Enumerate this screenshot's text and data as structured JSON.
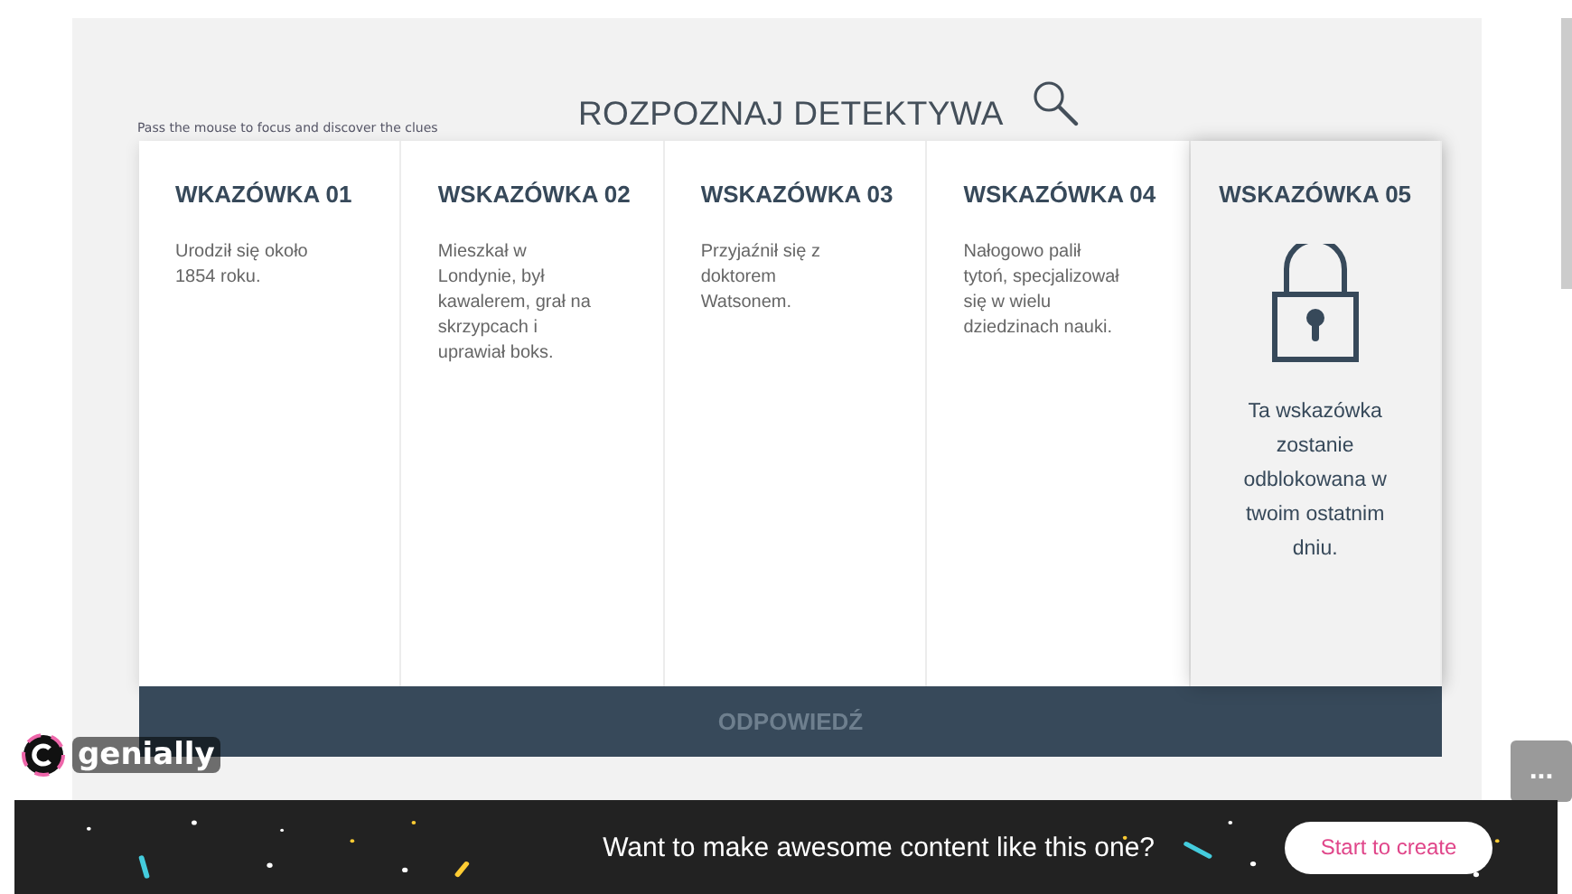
{
  "hint": "Pass the mouse to focus and discover the clues",
  "title": "ROZPOZNAJ DETEKTYWA",
  "clues": [
    {
      "label": "WKAZÓWKA 01",
      "locked": false,
      "text": "Urodził się około 1854 roku."
    },
    {
      "label": "WSKAZÓWKA 02",
      "locked": false,
      "text": "Mieszkał w Londynie, był kawalerem, grał na skrzypcach i uprawiał boks."
    },
    {
      "label": "WSKAZÓWKA 03",
      "locked": false,
      "text": "Przyjaźnił się z doktorem Watsonem."
    },
    {
      "label": "WSKAZÓWKA 04",
      "locked": false,
      "text": "Nałogowo palił tytoń, specjalizował się w wielu dziedzinach nauki."
    },
    {
      "label": "WSKAZÓWKA 05",
      "locked": true,
      "text": "Ta wskazówka zostanie odblokowana w twoim ostatnim dniu."
    }
  ],
  "answer_label": "ODPOWIEDŹ",
  "brand": "genially",
  "more_button": "...",
  "banner": {
    "text": "Want to make awesome content like this one?",
    "button": "Start to create"
  }
}
